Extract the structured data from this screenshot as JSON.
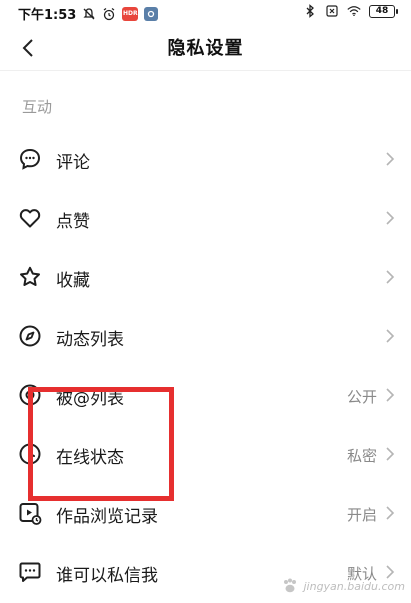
{
  "status_bar": {
    "time": "下午1:53",
    "red_badge_text": "HDR",
    "battery": "48"
  },
  "header": {
    "title": "隐私设置"
  },
  "section": {
    "label": "互动"
  },
  "items": [
    {
      "label": "评论",
      "value": "",
      "icon": "comment-icon"
    },
    {
      "label": "点赞",
      "value": "",
      "icon": "heart-icon"
    },
    {
      "label": "收藏",
      "value": "",
      "icon": "star-icon"
    },
    {
      "label": "动态列表",
      "value": "",
      "icon": "compass-icon"
    },
    {
      "label": "被@列表",
      "value": "公开",
      "icon": "at-icon"
    },
    {
      "label": "在线状态",
      "value": "私密",
      "icon": "online-status-icon"
    },
    {
      "label": "作品浏览记录",
      "value": "开启",
      "icon": "view-history-icon"
    },
    {
      "label": "谁可以私信我",
      "value": "默认",
      "icon": "message-icon"
    }
  ],
  "colors": {
    "highlight": "#e62f2f",
    "secondary_text": "#8a8a8a",
    "section_label": "#9a9a9a"
  },
  "watermark": {
    "text": "jingyan.baidu.com"
  }
}
